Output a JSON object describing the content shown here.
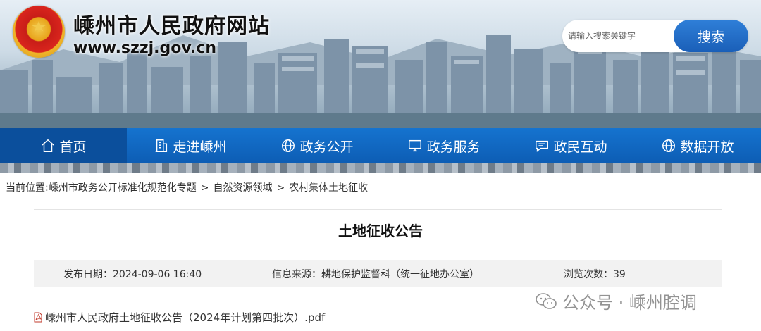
{
  "header": {
    "site_title": "嵊州市人民政府网站",
    "site_url": "www.szzj.gov.cn"
  },
  "search": {
    "placeholder": "请输入搜索关键字",
    "button_label": "搜索"
  },
  "nav": {
    "items": [
      {
        "label": "首页",
        "icon": "home-icon"
      },
      {
        "label": "走进嵊州",
        "icon": "building-icon"
      },
      {
        "label": "政务公开",
        "icon": "globe-icon"
      },
      {
        "label": "政务服务",
        "icon": "monitor-icon"
      },
      {
        "label": "政民互动",
        "icon": "chat-icon"
      },
      {
        "label": "数据开放",
        "icon": "globe-icon"
      }
    ]
  },
  "breadcrumb": {
    "prefix": "当前位置:",
    "items": [
      "嵊州市政务公开标准化规范化专题",
      "自然资源领域",
      "农村集体土地征收"
    ],
    "separator": ">"
  },
  "article": {
    "title": "土地征收公告",
    "publish_date": "发布日期：2024-09-06 16:40",
    "source": "信息来源：耕地保护监督科（统一征地办公室）",
    "views": "浏览次数：39"
  },
  "attachment": {
    "filename": "嵊州市人民政府土地征收公告（2024年计划第四批次）.pdf",
    "icon": "pdf-icon"
  },
  "watermark": {
    "text": "公众号 · 嵊州腔调",
    "icon": "wechat-icon"
  },
  "colors": {
    "nav_bg": "#1573cf",
    "search_button": "#1a5fb8",
    "meta_bg": "#f2f2f2"
  }
}
